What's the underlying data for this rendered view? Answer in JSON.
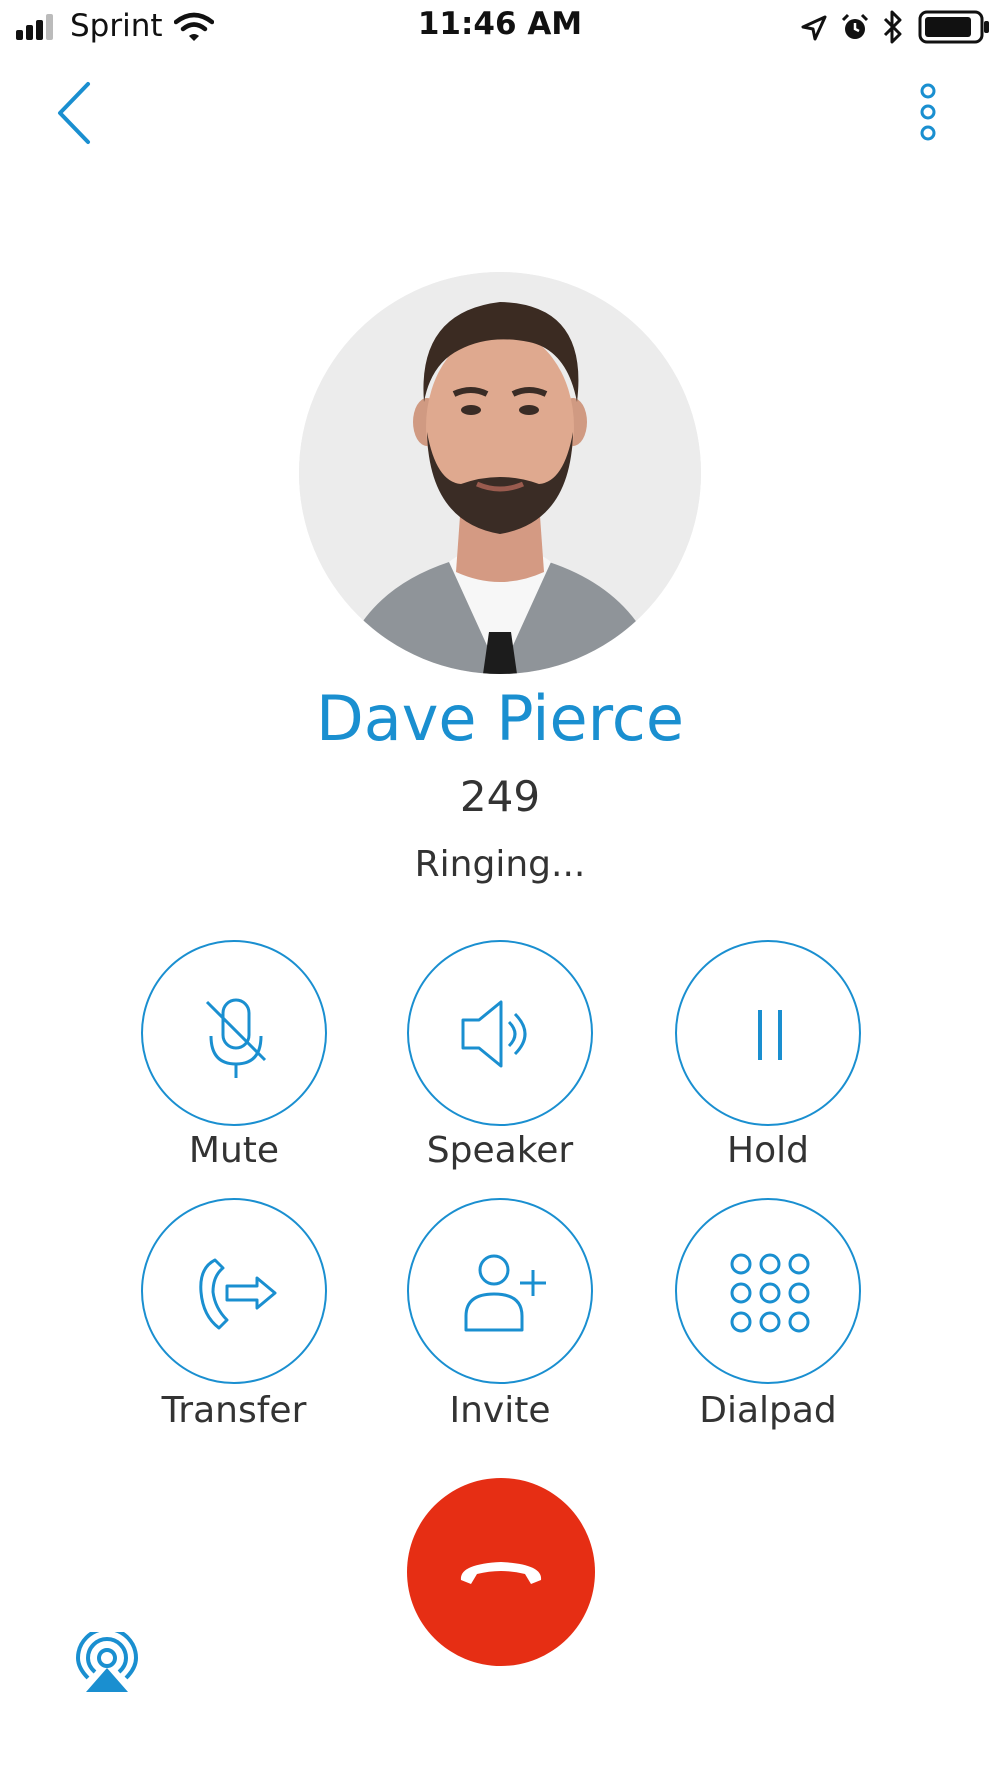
{
  "status_bar": {
    "carrier": "Sprint",
    "time": "11:46 AM"
  },
  "contact": {
    "name": "Dave Pierce",
    "extension": "249",
    "call_status": "Ringing..."
  },
  "controls": [
    {
      "label": "Mute",
      "icon": "microphone-off-icon"
    },
    {
      "label": "Speaker",
      "icon": "speaker-icon"
    },
    {
      "label": "Hold",
      "icon": "pause-icon"
    },
    {
      "label": "Transfer",
      "icon": "transfer-call-icon"
    },
    {
      "label": "Invite",
      "icon": "add-person-icon"
    },
    {
      "label": "Dialpad",
      "icon": "dialpad-icon"
    }
  ],
  "colors": {
    "accent": "#1a8fd0",
    "end_call": "#e62e14"
  }
}
